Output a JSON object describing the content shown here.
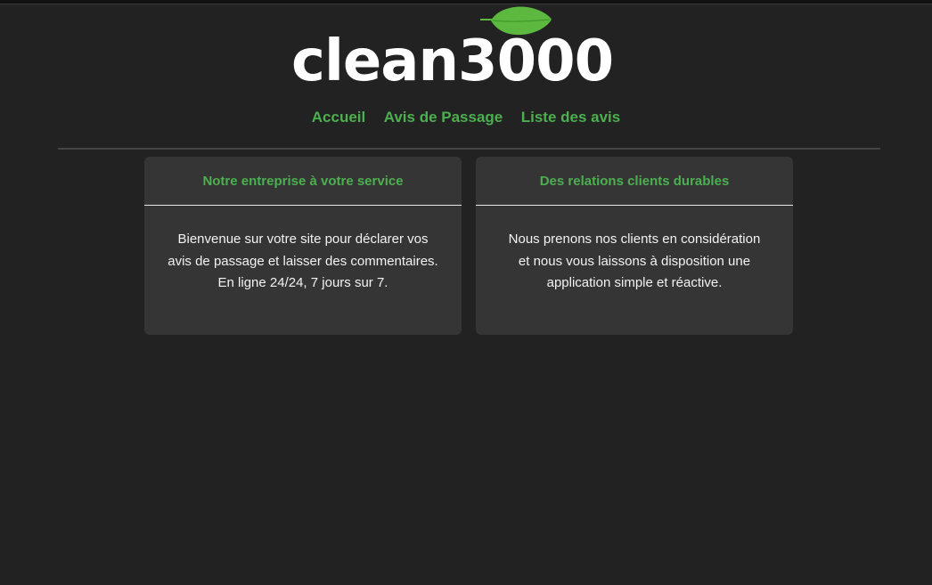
{
  "brand": {
    "name": "clean3000",
    "leaf_icon": "leaf-icon",
    "leaf_color": "#5cb83e",
    "text_color": "#ffffff"
  },
  "nav": {
    "items": [
      {
        "label": "Accueil"
      },
      {
        "label": "Avis de Passage"
      },
      {
        "label": "Liste des avis"
      }
    ],
    "link_color": "#4caf50"
  },
  "cards": [
    {
      "title": "Notre entreprise à votre service",
      "lines": [
        "Bienvenue sur votre site pour déclarer vos",
        "avis de passage et laisser des commentaires.",
        "En ligne 24/24, 7 jours sur 7."
      ]
    },
    {
      "title": "Des relations clients durables",
      "lines": [
        "Nous prenons nos clients en considération",
        "et nous vous laissons à disposition une",
        "application simple et réactive."
      ]
    }
  ],
  "colors": {
    "background": "#222222",
    "card_background": "#353535",
    "accent": "#4caf50"
  }
}
